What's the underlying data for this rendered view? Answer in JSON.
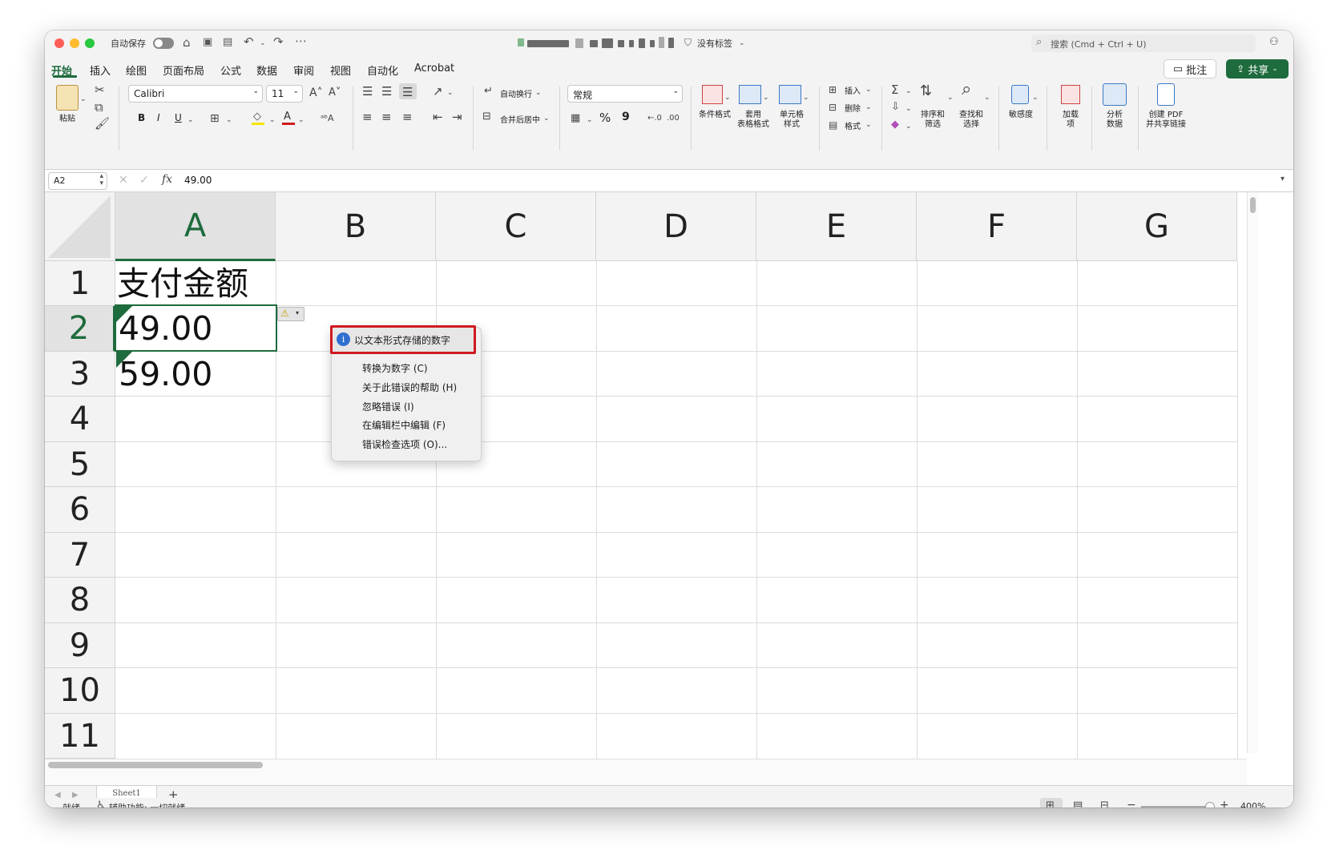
{
  "titlebar": {
    "autosave_label": "自动保存",
    "sensitivity_label": "没有标签",
    "search_placeholder": "搜索 (Cmd + Ctrl + U)"
  },
  "menu_tabs": [
    "开始",
    "插入",
    "绘图",
    "页面布局",
    "公式",
    "数据",
    "审阅",
    "视图",
    "自动化",
    "Acrobat"
  ],
  "top_buttons": {
    "comments": "批注",
    "share": "共享"
  },
  "ribbon": {
    "paste": "粘贴",
    "font_name": "Calibri",
    "font_size": "11",
    "bold": "B",
    "italic": "I",
    "underline": "U",
    "wrap_text": "自动换行",
    "merge_center": "合并后居中",
    "number_format": "常规",
    "percent": "%",
    "comma": "9",
    "conditional_format": "条件格式",
    "format_as_table": "套用\n表格格式",
    "cell_styles": "单元格\n样式",
    "insert": "插入",
    "delete": "删除",
    "format": "格式",
    "sort_filter": "排序和\n筛选",
    "find_select": "查找和\n选择",
    "sensitivity": "敏感度",
    "addins": "加载\n项",
    "analyze_data": "分析\n数据",
    "create_pdf": "创建 PDF\n并共享链接"
  },
  "formula_bar": {
    "name_box": "A2",
    "fx": "fx",
    "value": "49.00"
  },
  "columns": [
    "A",
    "B",
    "C",
    "D",
    "E",
    "F",
    "G"
  ],
  "rows": [
    "1",
    "2",
    "3",
    "4",
    "5",
    "6",
    "7",
    "8",
    "9",
    "10",
    "11"
  ],
  "cells": {
    "A1": "支付金额",
    "A2": "49.00",
    "A3": "59.00"
  },
  "error_menu": {
    "header": "以文本形式存储的数字",
    "items": [
      "转换为数字 (C)",
      "关于此错误的帮助 (H)",
      "忽略错误 (I)",
      "在编辑栏中编辑 (F)",
      "错误检查选项 (O)..."
    ]
  },
  "sheet_tab": "Sheet1",
  "add_sheet": "+",
  "status": {
    "ready": "就绪",
    "accessibility": "辅助功能: 一切就绪",
    "zoom": "400%"
  },
  "colors": {
    "accent_green": "#1e6b3d",
    "error_red": "#d0191f",
    "info_blue": "#2f6fd0"
  }
}
